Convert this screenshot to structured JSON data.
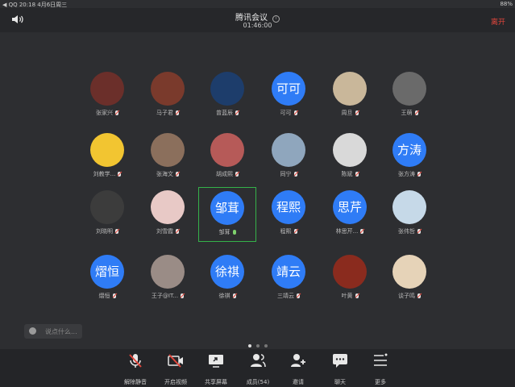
{
  "status_bar": {
    "left": "◀ QQ  20:18  4月6日周三",
    "right": "88%"
  },
  "meeting": {
    "title": "腾讯会议",
    "timer": "01:46:00",
    "leave_label": "离开"
  },
  "participants": [
    {
      "name": "张家兴",
      "avatar_text": "",
      "avatar_bg": "#6b2f2a",
      "mic": "off"
    },
    {
      "name": "马子君",
      "avatar_text": "",
      "avatar_bg": "#7a3a2c",
      "mic": "off"
    },
    {
      "name": "曾蓝辰",
      "avatar_text": "",
      "avatar_bg": "#1d3d6b",
      "mic": "off"
    },
    {
      "name": "可可",
      "avatar_text": "可可",
      "avatar_bg": "#2f7cf6",
      "mic": "off"
    },
    {
      "name": "周旦",
      "avatar_text": "",
      "avatar_bg": "#c9b79a",
      "mic": "off"
    },
    {
      "name": "王萌",
      "avatar_text": "",
      "avatar_bg": "#6a6a6a",
      "mic": "off"
    },
    {
      "name": "刘教学...",
      "avatar_text": "",
      "avatar_bg": "#f2c531",
      "mic": "off"
    },
    {
      "name": "张海文",
      "avatar_text": "",
      "avatar_bg": "#8b6f5c",
      "mic": "off"
    },
    {
      "name": "胡成熙",
      "avatar_text": "",
      "avatar_bg": "#b65a58",
      "mic": "off"
    },
    {
      "name": "同宁",
      "avatar_text": "",
      "avatar_bg": "#8fa6bd",
      "mic": "off"
    },
    {
      "name": "陈斌",
      "avatar_text": "",
      "avatar_bg": "#d9d9d9",
      "mic": "off"
    },
    {
      "name": "张方涛",
      "avatar_text": "方涛",
      "avatar_bg": "#2f7cf6",
      "mic": "off"
    },
    {
      "name": "刘晓明",
      "avatar_text": "",
      "avatar_bg": "#3c3c3c",
      "mic": "off"
    },
    {
      "name": "刘雪霞",
      "avatar_text": "",
      "avatar_bg": "#e8c9c6",
      "mic": "off"
    },
    {
      "name": "邹茸",
      "avatar_text": "邹茸",
      "avatar_bg": "#2f7cf6",
      "mic": "on",
      "active": true
    },
    {
      "name": "程熙",
      "avatar_text": "程熙",
      "avatar_bg": "#2f7cf6",
      "mic": "off"
    },
    {
      "name": "林思芹...",
      "avatar_text": "思芹",
      "avatar_bg": "#2f7cf6",
      "mic": "off"
    },
    {
      "name": "张伟哲",
      "avatar_text": "",
      "avatar_bg": "#c6d9e8",
      "mic": "off"
    },
    {
      "name": "熠恒",
      "avatar_text": "熠恒",
      "avatar_bg": "#2f7cf6",
      "mic": "off"
    },
    {
      "name": "王子@IT...",
      "avatar_text": "",
      "avatar_bg": "#9a8c86",
      "mic": "off"
    },
    {
      "name": "徐祺",
      "avatar_text": "徐祺",
      "avatar_bg": "#2f7cf6",
      "mic": "off"
    },
    {
      "name": "三靖云",
      "avatar_text": "靖云",
      "avatar_bg": "#2f7cf6",
      "mic": "off"
    },
    {
      "name": "叶黄",
      "avatar_text": "",
      "avatar_bg": "#8a2b1e",
      "mic": "off"
    },
    {
      "name": "谈子鸣",
      "avatar_text": "",
      "avatar_bg": "#e6d3b8",
      "mic": "off"
    }
  ],
  "pagination": {
    "pages": 3,
    "current": 1
  },
  "chat": {
    "placeholder": "说点什么..."
  },
  "toolbar": [
    {
      "label": "解除静音",
      "icon": "mic-off-icon"
    },
    {
      "label": "开启视频",
      "icon": "video-off-icon"
    },
    {
      "label": "共享屏幕",
      "icon": "share-screen-icon"
    },
    {
      "label": "成员(54)",
      "icon": "members-icon"
    },
    {
      "label": "邀请",
      "icon": "invite-icon"
    },
    {
      "label": "聊天",
      "icon": "chat-icon"
    },
    {
      "label": "更多",
      "icon": "more-icon"
    }
  ]
}
